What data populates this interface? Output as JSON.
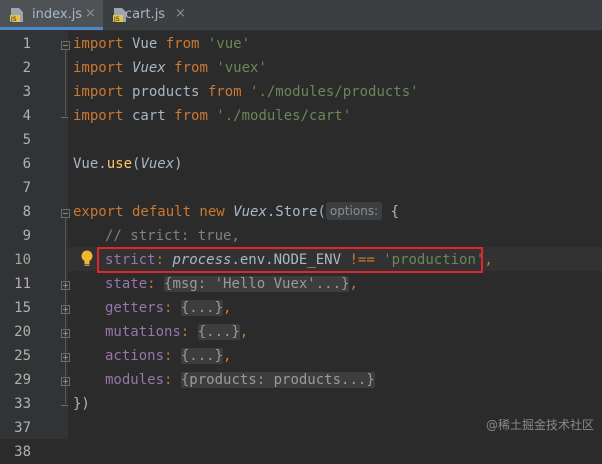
{
  "tabs": [
    {
      "label": "index.js",
      "active": true,
      "icon": "js-file-icon"
    },
    {
      "label": "cart.js",
      "active": false,
      "icon": "js-file-icon"
    }
  ],
  "line_numbers": [
    "1",
    "2",
    "3",
    "4",
    "5",
    "6",
    "7",
    "8",
    "9",
    "10",
    "11",
    "15",
    "20",
    "25",
    "29",
    "33",
    "37",
    "38"
  ],
  "code": {
    "l1": {
      "kw": "import",
      "a": " Vue ",
      "kw2": "from",
      "s": " 'vue'"
    },
    "l2": {
      "kw": "import",
      "a": " ",
      "it": "Vuex",
      "b": " ",
      "kw2": "from",
      "s": " 'vuex'"
    },
    "l3": {
      "kw": "import",
      "a": " products ",
      "kw2": "from",
      "s": " './modules/products'"
    },
    "l4": {
      "kw": "import",
      "a": " cart ",
      "kw2": "from",
      "s": " './modules/cart'"
    },
    "l6": {
      "a": "Vue.",
      "fn": "use",
      "b": "(",
      "it": "Vuex",
      "c": ")"
    },
    "l8": {
      "kw": "export default new",
      "a": " ",
      "it": "Vuex",
      "b": ".Store(",
      "hint": "options:",
      "c": " {"
    },
    "l9": {
      "cmt": "// strict: true,"
    },
    "l10": {
      "a": "strict",
      "b": ": ",
      "it": "process",
      "c": ".env.NODE_ENV ",
      "op": "!==",
      "s": " 'production'",
      "d": ","
    },
    "l11": {
      "a": "state",
      "b": ": ",
      "fold": "{msg: 'Hello Vuex'...}",
      "c": ","
    },
    "l15": {
      "a": "getters",
      "b": ": ",
      "fold": "{...}",
      "c": ","
    },
    "l20": {
      "a": "mutations",
      "b": ": ",
      "fold": "{...}",
      "c": ","
    },
    "l25": {
      "a": "actions",
      "b": ": ",
      "fold": "{...}",
      "c": ","
    },
    "l29": {
      "a": "modules",
      "b": ": ",
      "fold": "{products: products...}"
    },
    "l33": {
      "a": "})"
    }
  },
  "watermark": "@稀土掘金技术社区",
  "colors": {
    "highlight_box": "#e0262c",
    "keyword": "#cc7832",
    "string": "#6a8759"
  }
}
